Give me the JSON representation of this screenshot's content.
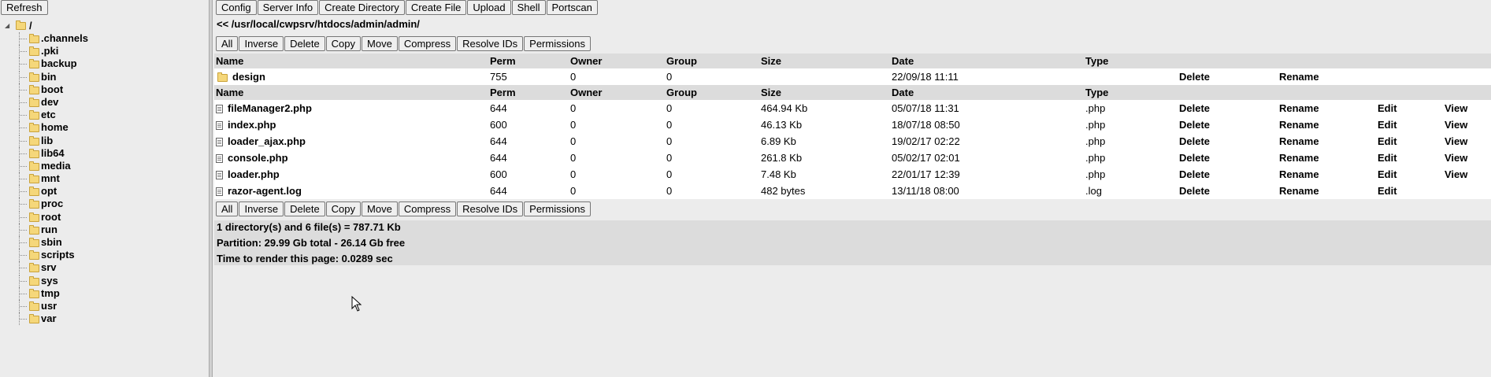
{
  "left_panel": {
    "refresh_label": "Refresh",
    "root_label": "/",
    "tree_items": [
      ".channels",
      ".pki",
      "backup",
      "bin",
      "boot",
      "dev",
      "etc",
      "home",
      "lib",
      "lib64",
      "media",
      "mnt",
      "opt",
      "proc",
      "root",
      "run",
      "sbin",
      "scripts",
      "srv",
      "sys",
      "tmp",
      "usr",
      "var"
    ]
  },
  "toolbar": {
    "buttons": [
      "Config",
      "Server Info",
      "Create Directory",
      "Create File",
      "Upload",
      "Shell",
      "Portscan"
    ]
  },
  "path": "<< /usr/local/cwpsrv/htdocs/admin/admin/",
  "actions": [
    "All",
    "Inverse",
    "Delete",
    "Copy",
    "Move",
    "Compress",
    "Resolve IDs",
    "Permissions"
  ],
  "columns": [
    "Name",
    "Perm",
    "Owner",
    "Group",
    "Size",
    "Date",
    "Type"
  ],
  "directories": [
    {
      "name": "design",
      "perm": "755",
      "owner": "0",
      "group": "0",
      "size": "",
      "date": "22/09/18 11:11",
      "type": "",
      "delete": "Delete",
      "rename": "Rename"
    }
  ],
  "files": [
    {
      "name": "fileManager2.php",
      "perm": "644",
      "owner": "0",
      "group": "0",
      "size": "464.94 Kb",
      "date": "05/07/18 11:31",
      "type": ".php",
      "delete": "Delete",
      "rename": "Rename",
      "edit": "Edit",
      "view": "View"
    },
    {
      "name": "index.php",
      "perm": "600",
      "owner": "0",
      "group": "0",
      "size": "46.13 Kb",
      "date": "18/07/18 08:50",
      "type": ".php",
      "delete": "Delete",
      "rename": "Rename",
      "edit": "Edit",
      "view": "View"
    },
    {
      "name": "loader_ajax.php",
      "perm": "644",
      "owner": "0",
      "group": "0",
      "size": "6.89 Kb",
      "date": "19/02/17 02:22",
      "type": ".php",
      "delete": "Delete",
      "rename": "Rename",
      "edit": "Edit",
      "view": "View"
    },
    {
      "name": "console.php",
      "perm": "644",
      "owner": "0",
      "group": "0",
      "size": "261.8 Kb",
      "date": "05/02/17 02:01",
      "type": ".php",
      "delete": "Delete",
      "rename": "Rename",
      "edit": "Edit",
      "view": "View"
    },
    {
      "name": "loader.php",
      "perm": "600",
      "owner": "0",
      "group": "0",
      "size": "7.48 Kb",
      "date": "22/01/17 12:39",
      "type": ".php",
      "delete": "Delete",
      "rename": "Rename",
      "edit": "Edit",
      "view": "View"
    },
    {
      "name": "razor-agent.log",
      "perm": "644",
      "owner": "0",
      "group": "0",
      "size": "482 bytes",
      "date": "13/11/18 08:00",
      "type": ".log",
      "delete": "Delete",
      "rename": "Rename",
      "edit": "Edit",
      "view": ""
    }
  ],
  "summary": {
    "counts": "1 directory(s) and 6 file(s) = 787.71 Kb",
    "partition": "Partition: 29.99 Gb total - 26.14 Gb free",
    "render_time": "Time to render this page: 0.0289 sec"
  }
}
